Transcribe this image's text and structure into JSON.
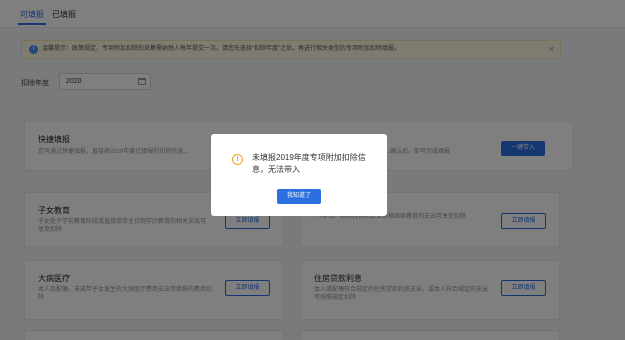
{
  "tabs": [
    {
      "label": "可填报"
    },
    {
      "label": "已填报"
    }
  ],
  "notice": {
    "text": "温馨提示：政策规定，专项附加扣除的采集需纳税人每年提交一次。请您先选择“扣除年度”之后，再进行相关类型的专项附加扣除填报。"
  },
  "year": {
    "label": "扣除年度",
    "value": "2020"
  },
  "quick_fill": {
    "title": "快捷填报",
    "desc": "您可通过快捷填报，直接将2019年度已填报的扣除信息...",
    "right_desc": "...确认后，即可完成填报",
    "button": "一键带入"
  },
  "children_edu": {
    "title": "子女教育",
    "desc": "子女处于学前教育阶段或直接接受全日制学历教育的相关支出可享受扣除",
    "button": "立即填报"
  },
  "continuing_edu": {
    "desc": "...（学位）继续教育和职业资格继续教育的支出可享受扣除",
    "button": "立即填报"
  },
  "medical": {
    "title": "大病医疗",
    "desc": "本人及配偶、未成年子女发生的大病医疗费用支出可填报的费用扣除",
    "button": "立即填报"
  },
  "housing_loan": {
    "title": "住房贷款利息",
    "desc": "本人或配偶符合规定的住房贷款利息支出，或本人符合规定的支出可按照规定扣除",
    "button": "立即填报"
  },
  "modal": {
    "message": "未填报2019年度专项附加扣除信息，无法带入",
    "button": "我知道了"
  },
  "colors": {
    "primary": "#2b6fe0",
    "warning": "#f0a020"
  }
}
